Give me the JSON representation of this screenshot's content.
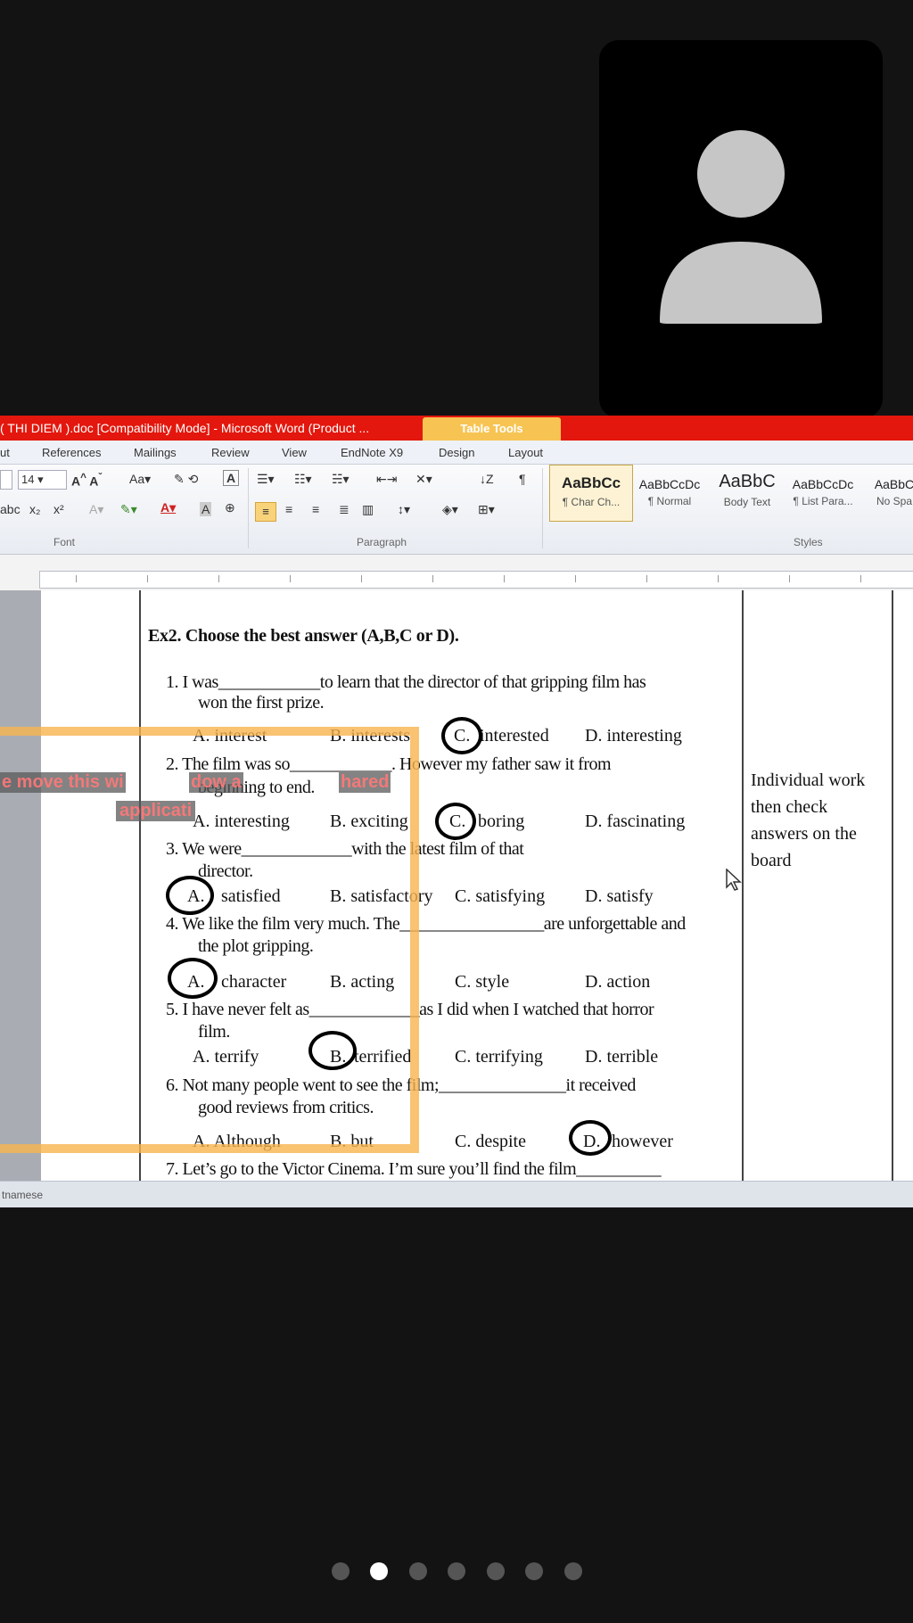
{
  "participant": {
    "avatar_icon": "person-silhouette-icon"
  },
  "word": {
    "title": "( THI DIEM ).doc [Compatibility Mode] - Microsoft Word (Product ...",
    "table_tools": "Table Tools",
    "tabs": [
      "References",
      "Mailings",
      "Review",
      "View",
      "EndNote X9",
      "Design",
      "Layout"
    ],
    "tab_partial": "ut",
    "font_size": "14",
    "group_labels": {
      "font": "Font",
      "paragraph": "Paragraph",
      "styles": "Styles"
    },
    "styles": [
      {
        "preview": "AaBbCc",
        "name": "¶ Char Ch..."
      },
      {
        "preview": "AaBbCcDc",
        "name": "¶ Normal"
      },
      {
        "preview": "AaBbC",
        "name": "Body Text"
      },
      {
        "preview": "AaBbCcDc",
        "name": "¶ List Para..."
      },
      {
        "preview": "AaBbC",
        "name": "No Spa"
      }
    ],
    "status_language": "tnamese"
  },
  "document": {
    "heading": "Ex2. Choose the best answer (A,B,C or D).",
    "questions": [
      {
        "lines": [
          "1.  I was____________to learn that the director of that gripping film has",
          "won the first prize."
        ],
        "options": [
          "A.  interest",
          "B.  interests",
          "C.",
          "interested",
          "D.  interesting"
        ]
      },
      {
        "lines": [
          "2.  The film was so____________. However my father saw it from",
          "beginning to end."
        ],
        "options": [
          "A.  interesting",
          "B.  exciting",
          "C.",
          "boring",
          "D.  fascinating"
        ]
      },
      {
        "lines": [
          "3.  We were_____________with the latest film of that",
          "director."
        ],
        "options": [
          "A.",
          "satisfied",
          "B.  satisfactory",
          "C.  satisfying",
          "D.  satisfy"
        ]
      },
      {
        "lines": [
          "4.  We like the film very much. The_________________are unforgettable and",
          "the plot gripping."
        ],
        "options": [
          "A.",
          "character",
          "B.  acting",
          "C.  style",
          "D.  action"
        ]
      },
      {
        "lines": [
          "5.  I have never felt as_____________as I did when I watched that horror",
          "film."
        ],
        "options": [
          "A.  terrify",
          "B.",
          "terrified",
          "C.  terrifying",
          "D.  terrible"
        ]
      },
      {
        "lines": [
          "6.  Not many people went to see the film;_______________it received",
          "good reviews from critics."
        ],
        "options": [
          "A.  Although",
          "B.  but",
          "C.  despite",
          "D.",
          "however"
        ]
      },
      {
        "lines": [
          "7.  Let’s go to the Victor Cinema. I’m sure you’ll find the film__________"
        ]
      }
    ],
    "side_note": [
      "Individual work",
      "then check",
      "answers on the",
      "board"
    ]
  },
  "share_overlay": {
    "line1a": "e move this wi",
    "line1b": "dow a",
    "line1c": "hared",
    "line2": "applicati"
  },
  "pager": {
    "count": 7,
    "active_index": 1
  }
}
